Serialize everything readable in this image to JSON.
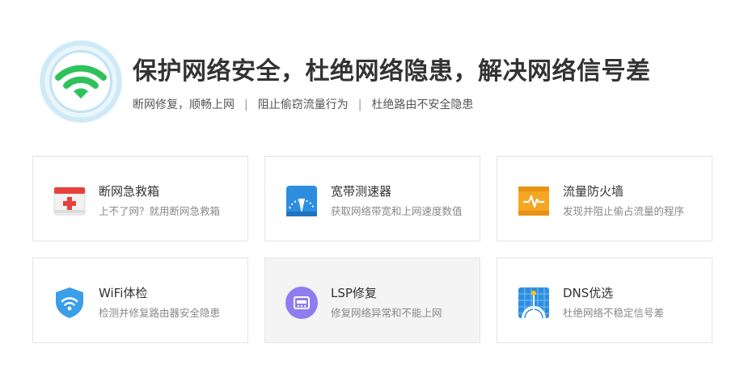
{
  "header": {
    "title": "保护网络安全，杜绝网络隐患，解决网络信号差",
    "subtitle_items": [
      "断网修复，顺畅上网",
      "阻止偷窃流量行为",
      "杜绝路由不安全隐患"
    ],
    "separator": "|"
  },
  "cards": [
    {
      "name": "断网急救箱",
      "desc": "上不了网？就用断网急救箱",
      "icon": "first-aid-kit-icon"
    },
    {
      "name": "宽带测速器",
      "desc": "获取网络带宽和上网速度数值",
      "icon": "speedometer-icon"
    },
    {
      "name": "流量防火墙",
      "desc": "发现并阻止偷占流量的程序",
      "icon": "firewall-icon"
    },
    {
      "name": "WiFi体检",
      "desc": "检测并修复路由器安全隐患",
      "icon": "wifi-shield-icon"
    },
    {
      "name": "LSP修复",
      "desc": "修复网络异常和不能上网",
      "icon": "network-port-icon"
    },
    {
      "name": "DNS优选",
      "desc": "杜绝网络不稳定信号差",
      "icon": "globe-antenna-icon"
    }
  ],
  "colors": {
    "wifi_green": "#2fc25b",
    "wifi_ring": "#bfe3f4",
    "speed_blue": "#2d8ee0",
    "firewall_orange": "#f5a623",
    "shield_blue": "#3a9ee8",
    "lsp_purple": "#8f7cf0",
    "dns_blue": "#2d8ee0",
    "aid_red": "#e8413b"
  }
}
